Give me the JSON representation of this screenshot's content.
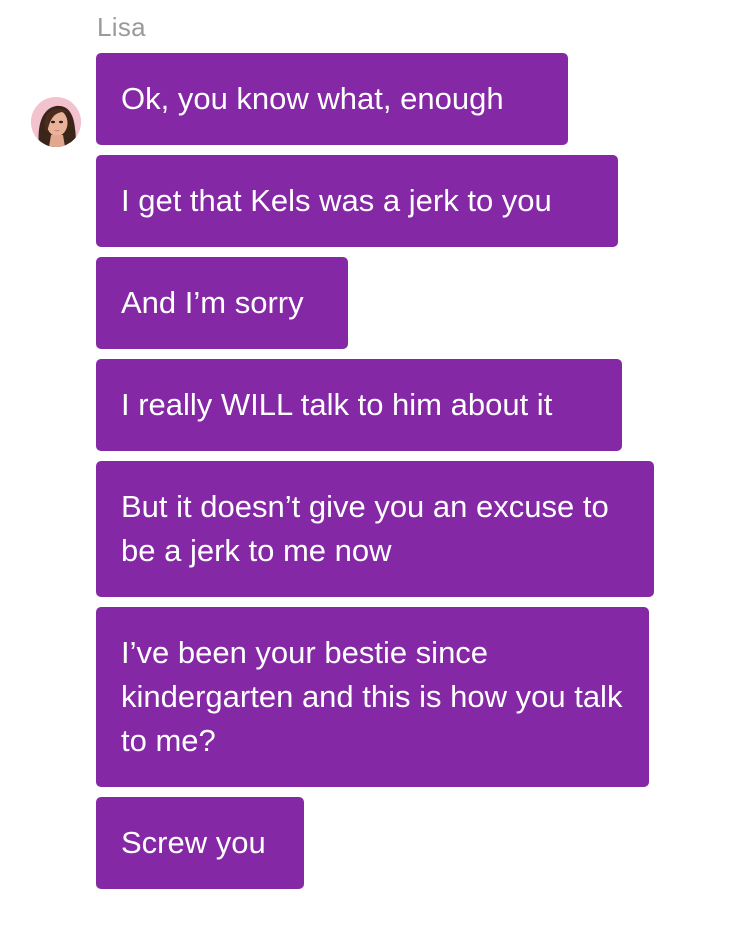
{
  "conversation": {
    "sender_name": "Lisa",
    "avatar_icon": "avatar-portrait-icon",
    "bubble_color": "#8428a6",
    "messages": [
      {
        "text": "Ok, you know what, enough"
      },
      {
        "text": "I get that Kels was a jerk to you"
      },
      {
        "text": "And I’m sorry"
      },
      {
        "text": "I really WILL talk to him about it"
      },
      {
        "text": "But it doesn’t give you an excuse to be a jerk to me now"
      },
      {
        "text": "I’ve been your bestie since kindergarten and this is how you talk to me?"
      },
      {
        "text": "Screw you"
      }
    ]
  }
}
